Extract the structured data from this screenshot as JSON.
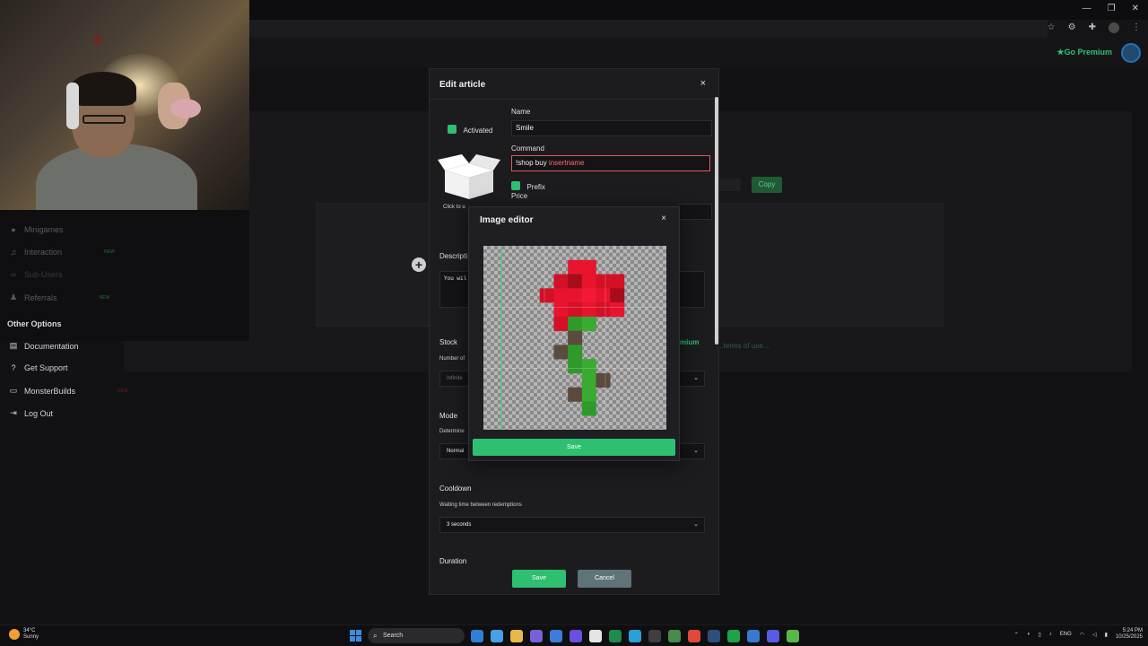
{
  "header": {
    "go_premium": "Go Premium"
  },
  "background": {
    "copy_label": "Copy",
    "terms_text": "...terms of use..."
  },
  "sidebar": {
    "items": [
      {
        "label": "Minigames",
        "icon": "gamepad-icon",
        "tag": ""
      },
      {
        "label": "Interaction",
        "icon": "music-icon",
        "tag": "NEW"
      },
      {
        "label": "Sub-Users",
        "icon": "link-icon",
        "tag": ""
      },
      {
        "label": "Referrals",
        "icon": "users-icon",
        "tag": "NEW"
      }
    ],
    "other_title": "Other Options",
    "other_items": [
      {
        "label": "Documentation",
        "icon": "document-icon",
        "tag": ""
      },
      {
        "label": "Get Support",
        "icon": "help-icon",
        "tag": ""
      },
      {
        "label": "MonsterBuilds",
        "icon": "monitor-icon",
        "tag": "NEW"
      },
      {
        "label": "Log Out",
        "icon": "logout-icon",
        "tag": ""
      }
    ]
  },
  "edit_modal": {
    "title": "Edit article",
    "close": "×",
    "activated_label": "Activated",
    "click_to_upload": "Click to u",
    "name_label": "Name",
    "name_value": "Smile",
    "command_label": "Command",
    "command_prefix": "!shop buy ",
    "command_placeholder": "insertname",
    "prefix_label": "Prefix",
    "price_label": "Price",
    "description_label": "Descripti",
    "description_value": "You wil",
    "stock_label": "Stock",
    "premium_label": "mium",
    "number_of_label": "Number of",
    "stock_value": "Infinite",
    "mode_label": "Mode",
    "determine_label": "Determine",
    "mode_value": "Normal",
    "cooldown_label": "Cooldown",
    "cooldown_hint": "Waiting time between redemptions",
    "cooldown_value": "3 seconds",
    "duration_label": "Duration",
    "save": "Save",
    "cancel": "Cancel"
  },
  "image_editor": {
    "title": "Image editor",
    "close": "×",
    "save": "Save",
    "pixel_grid": {
      "cols": 26,
      "rows": 26,
      "pixels": [
        [
          12,
          2,
          "#e8142d"
        ],
        [
          13,
          2,
          "#e8142d"
        ],
        [
          14,
          2,
          "#e8142d"
        ],
        [
          15,
          2,
          "#e8142d"
        ],
        [
          12,
          3,
          "#e8142d"
        ],
        [
          13,
          3,
          "#e8142d"
        ],
        [
          14,
          3,
          "#e8142d"
        ],
        [
          15,
          3,
          "#e8142d"
        ],
        [
          10,
          4,
          "#d31025"
        ],
        [
          11,
          4,
          "#d31025"
        ],
        [
          12,
          4,
          "#a80c1c"
        ],
        [
          13,
          4,
          "#a80c1c"
        ],
        [
          14,
          4,
          "#e8142d"
        ],
        [
          15,
          4,
          "#e8142d"
        ],
        [
          16,
          4,
          "#d31025"
        ],
        [
          17,
          4,
          "#d31025"
        ],
        [
          18,
          4,
          "#d31025"
        ],
        [
          19,
          4,
          "#d31025"
        ],
        [
          10,
          5,
          "#d31025"
        ],
        [
          11,
          5,
          "#d31025"
        ],
        [
          12,
          5,
          "#a80c1c"
        ],
        [
          13,
          5,
          "#a80c1c"
        ],
        [
          14,
          5,
          "#e8142d"
        ],
        [
          15,
          5,
          "#e8142d"
        ],
        [
          16,
          5,
          "#d31025"
        ],
        [
          17,
          5,
          "#d31025"
        ],
        [
          18,
          5,
          "#d31025"
        ],
        [
          19,
          5,
          "#d31025"
        ],
        [
          8,
          6,
          "#d31025"
        ],
        [
          9,
          6,
          "#d31025"
        ],
        [
          10,
          6,
          "#e8142d"
        ],
        [
          11,
          6,
          "#e8142d"
        ],
        [
          12,
          6,
          "#e8142d"
        ],
        [
          13,
          6,
          "#e8142d"
        ],
        [
          14,
          6,
          "#f21a33"
        ],
        [
          15,
          6,
          "#f21a33"
        ],
        [
          16,
          6,
          "#e8142d"
        ],
        [
          17,
          6,
          "#e8142d"
        ],
        [
          18,
          6,
          "#a80c1c"
        ],
        [
          19,
          6,
          "#a80c1c"
        ],
        [
          8,
          7,
          "#d31025"
        ],
        [
          9,
          7,
          "#d31025"
        ],
        [
          10,
          7,
          "#e8142d"
        ],
        [
          11,
          7,
          "#e8142d"
        ],
        [
          12,
          7,
          "#e8142d"
        ],
        [
          13,
          7,
          "#e8142d"
        ],
        [
          14,
          7,
          "#f21a33"
        ],
        [
          15,
          7,
          "#f21a33"
        ],
        [
          16,
          7,
          "#e8142d"
        ],
        [
          17,
          7,
          "#e8142d"
        ],
        [
          18,
          7,
          "#a80c1c"
        ],
        [
          19,
          7,
          "#a80c1c"
        ],
        [
          10,
          8,
          "#e8142d"
        ],
        [
          11,
          8,
          "#e8142d"
        ],
        [
          12,
          8,
          "#d31025"
        ],
        [
          13,
          8,
          "#d31025"
        ],
        [
          14,
          8,
          "#e8142d"
        ],
        [
          15,
          8,
          "#e8142d"
        ],
        [
          16,
          8,
          "#d31025"
        ],
        [
          17,
          8,
          "#d31025"
        ],
        [
          18,
          8,
          "#e8142d"
        ],
        [
          19,
          8,
          "#e8142d"
        ],
        [
          10,
          9,
          "#e8142d"
        ],
        [
          11,
          9,
          "#e8142d"
        ],
        [
          12,
          9,
          "#d31025"
        ],
        [
          13,
          9,
          "#d31025"
        ],
        [
          14,
          9,
          "#e8142d"
        ],
        [
          15,
          9,
          "#e8142d"
        ],
        [
          16,
          9,
          "#d31025"
        ],
        [
          17,
          9,
          "#d31025"
        ],
        [
          18,
          9,
          "#e8142d"
        ],
        [
          19,
          9,
          "#e8142d"
        ],
        [
          10,
          10,
          "#d31025"
        ],
        [
          11,
          10,
          "#d31025"
        ],
        [
          12,
          10,
          "#2f9a2a"
        ],
        [
          13,
          10,
          "#2f9a2a"
        ],
        [
          14,
          10,
          "#3aaa30"
        ],
        [
          15,
          10,
          "#3aaa30"
        ],
        [
          10,
          11,
          "#d31025"
        ],
        [
          11,
          11,
          "#d31025"
        ],
        [
          12,
          11,
          "#2f9a2a"
        ],
        [
          13,
          11,
          "#2f9a2a"
        ],
        [
          14,
          11,
          "#3aaa30"
        ],
        [
          15,
          11,
          "#3aaa30"
        ],
        [
          12,
          12,
          "#5c4a3c"
        ],
        [
          13,
          12,
          "#5c4a3c"
        ],
        [
          12,
          13,
          "#5c4a3c"
        ],
        [
          13,
          13,
          "#5c4a3c"
        ],
        [
          10,
          14,
          "#5c4a3c"
        ],
        [
          11,
          14,
          "#5c4a3c"
        ],
        [
          12,
          14,
          "#2f9a2a"
        ],
        [
          13,
          14,
          "#2f9a2a"
        ],
        [
          10,
          15,
          "#5c4a3c"
        ],
        [
          11,
          15,
          "#5c4a3c"
        ],
        [
          12,
          15,
          "#2f9a2a"
        ],
        [
          13,
          15,
          "#2f9a2a"
        ],
        [
          12,
          16,
          "#2f9a2a"
        ],
        [
          13,
          16,
          "#2f9a2a"
        ],
        [
          14,
          16,
          "#3aaa30"
        ],
        [
          15,
          16,
          "#3aaa30"
        ],
        [
          12,
          17,
          "#2f9a2a"
        ],
        [
          13,
          17,
          "#2f9a2a"
        ],
        [
          14,
          17,
          "#3aaa30"
        ],
        [
          15,
          17,
          "#3aaa30"
        ],
        [
          14,
          18,
          "#3aaa30"
        ],
        [
          15,
          18,
          "#3aaa30"
        ],
        [
          16,
          18,
          "#5c4a3c"
        ],
        [
          17,
          18,
          "#5c4a3c"
        ],
        [
          14,
          19,
          "#3aaa30"
        ],
        [
          15,
          19,
          "#3aaa30"
        ],
        [
          16,
          19,
          "#5c4a3c"
        ],
        [
          17,
          19,
          "#5c4a3c"
        ],
        [
          12,
          20,
          "#5c4a3c"
        ],
        [
          13,
          20,
          "#5c4a3c"
        ],
        [
          14,
          20,
          "#3aaa30"
        ],
        [
          15,
          20,
          "#3aaa30"
        ],
        [
          12,
          21,
          "#5c4a3c"
        ],
        [
          13,
          21,
          "#5c4a3c"
        ],
        [
          14,
          21,
          "#3aaa30"
        ],
        [
          15,
          21,
          "#3aaa30"
        ],
        [
          14,
          22,
          "#2f9a2a"
        ],
        [
          15,
          22,
          "#2f9a2a"
        ],
        [
          14,
          23,
          "#2f9a2a"
        ],
        [
          15,
          23,
          "#2f9a2a"
        ]
      ]
    }
  },
  "taskbar": {
    "weather_temp": "34°C",
    "weather_desc": "Sunny",
    "search_label": "Search",
    "lang": "ENG",
    "time": "5:24 PM",
    "date": "10/25/2025"
  },
  "colors": {
    "accent_green": "#2fbf71",
    "error_red": "#e0575c",
    "cancel_gray": "#5f7379"
  }
}
